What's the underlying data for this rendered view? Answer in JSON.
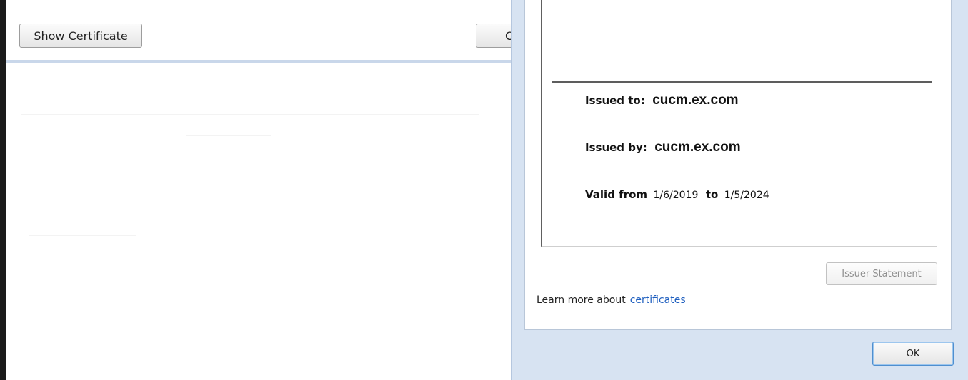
{
  "left": {
    "show_certificate_label": "Show Certificate",
    "partial_button_label": "C"
  },
  "certificate": {
    "issued_to_label": "Issued to:",
    "issued_to_value": "cucm.ex.com",
    "issued_by_label": "Issued by:",
    "issued_by_value": "cucm.ex.com",
    "valid_from_label": "Valid from",
    "valid_from_value": "1/6/2019",
    "to_label": "to",
    "valid_to_value": "1/5/2024"
  },
  "dialog": {
    "issuer_statement_label": "Issuer Statement",
    "learn_more_text": "Learn more about",
    "learn_more_link": "certificates",
    "ok_label": "OK"
  }
}
